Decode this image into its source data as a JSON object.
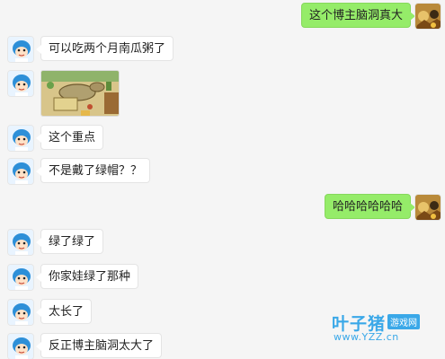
{
  "messages": [
    {
      "side": "right",
      "type": "text",
      "text": "这个博主脑洞真大"
    },
    {
      "side": "left",
      "type": "text",
      "text": "可以吃两个月南瓜粥了"
    },
    {
      "side": "left",
      "type": "image",
      "icon": "game-screenshot-image"
    },
    {
      "side": "left",
      "type": "text",
      "text": "这个重点"
    },
    {
      "side": "left",
      "type": "text",
      "text": "不是戴了绿帽？？"
    },
    {
      "side": "right",
      "type": "text",
      "text": "哈哈哈哈哈哈"
    },
    {
      "side": "left",
      "type": "text",
      "text": "绿了绿了"
    },
    {
      "side": "left",
      "type": "text",
      "text": "你家娃绿了那种"
    },
    {
      "side": "left",
      "type": "text",
      "text": "太长了"
    },
    {
      "side": "left",
      "type": "text",
      "text": "反正博主脑洞太大了"
    }
  ],
  "watermark": {
    "title": "叶子猪",
    "tag": "游戏网",
    "url": "www.YZZ.cn"
  },
  "colors": {
    "right_bubble": "#95ec69",
    "left_bubble": "#ffffff",
    "background": "#f5f5f5",
    "watermark": "#3aa8e8"
  }
}
